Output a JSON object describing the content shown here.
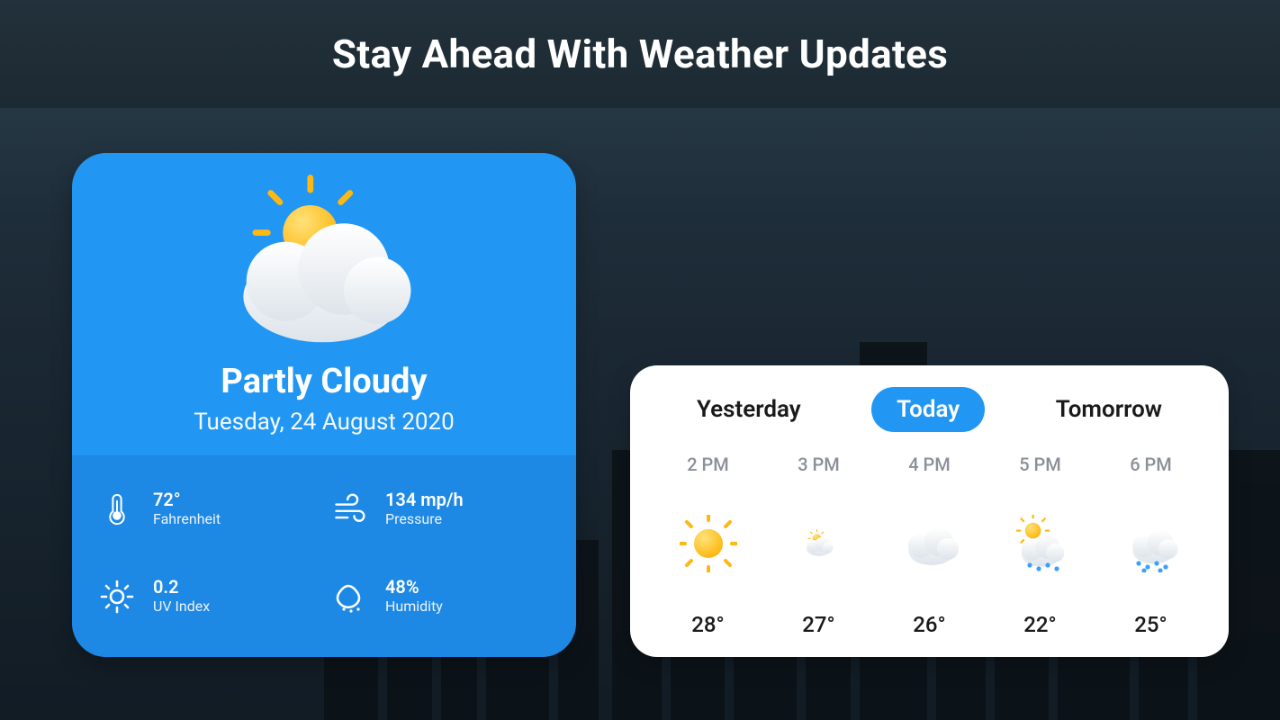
{
  "header": {
    "title": "Stay Ahead With Weather Updates"
  },
  "current": {
    "condition": "Partly Cloudy",
    "date": "Tuesday, 24 August 2020",
    "metrics": {
      "temperature": {
        "value": "72°",
        "label": "Fahrenheit",
        "icon": "thermometer-icon"
      },
      "pressure": {
        "value": "134 mp/h",
        "label": "Pressure",
        "icon": "wind-icon"
      },
      "uv": {
        "value": "0.2",
        "label": "UV Index",
        "icon": "sun-icon"
      },
      "humidity": {
        "value": "48%",
        "label": "Humidity",
        "icon": "humidity-icon"
      }
    },
    "icon": "partly-cloudy-icon"
  },
  "forecast": {
    "tabs": [
      {
        "id": "yesterday",
        "label": "Yesterday",
        "active": false
      },
      {
        "id": "today",
        "label": "Today",
        "active": true
      },
      {
        "id": "tomorrow",
        "label": "Tomorrow",
        "active": false
      }
    ],
    "hours": [
      {
        "time": "2 PM",
        "icon": "sunny-icon",
        "temp": "28°"
      },
      {
        "time": "3 PM",
        "icon": "partly-cloudy-icon",
        "temp": "27°"
      },
      {
        "time": "4 PM",
        "icon": "cloudy-icon",
        "temp": "26°"
      },
      {
        "time": "5 PM",
        "icon": "sun-rain-icon",
        "temp": "22°"
      },
      {
        "time": "6 PM",
        "icon": "rain-icon",
        "temp": "25°"
      }
    ]
  },
  "colors": {
    "accent": "#2196F3",
    "accent_dark": "#1E88E5",
    "white": "#ffffff"
  }
}
